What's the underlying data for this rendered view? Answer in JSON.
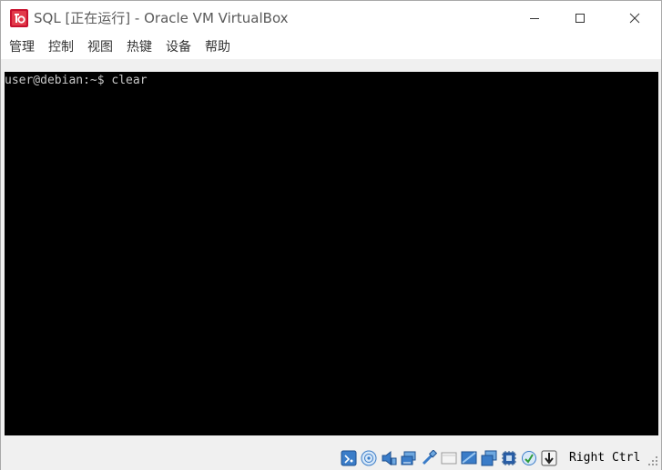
{
  "window": {
    "title": "SQL [正在运行] - Oracle VM VirtualBox"
  },
  "titlebar": {
    "app_icon": "virtualbox-vm-icon",
    "controls": [
      "minimize-icon",
      "maximize-icon",
      "close-icon"
    ]
  },
  "menubar": {
    "items": [
      {
        "label": "管理"
      },
      {
        "label": "控制"
      },
      {
        "label": "视图"
      },
      {
        "label": "热键"
      },
      {
        "label": "设备"
      },
      {
        "label": "帮助"
      }
    ]
  },
  "terminal": {
    "lines": [
      "user@debian:~$ clear"
    ],
    "background": "#000000",
    "foreground": "#c8c8c8"
  },
  "statusbar": {
    "indicators": [
      "hard-disk-icon",
      "optical-drive-icon",
      "audio-icon",
      "network-icon",
      "usb-icon",
      "shared-folders-icon",
      "display-icon",
      "video-capture-icon",
      "cpu-icon",
      "mouse-integration-icon",
      "keyboard-capture-icon"
    ],
    "host_key": "Right Ctrl"
  }
}
